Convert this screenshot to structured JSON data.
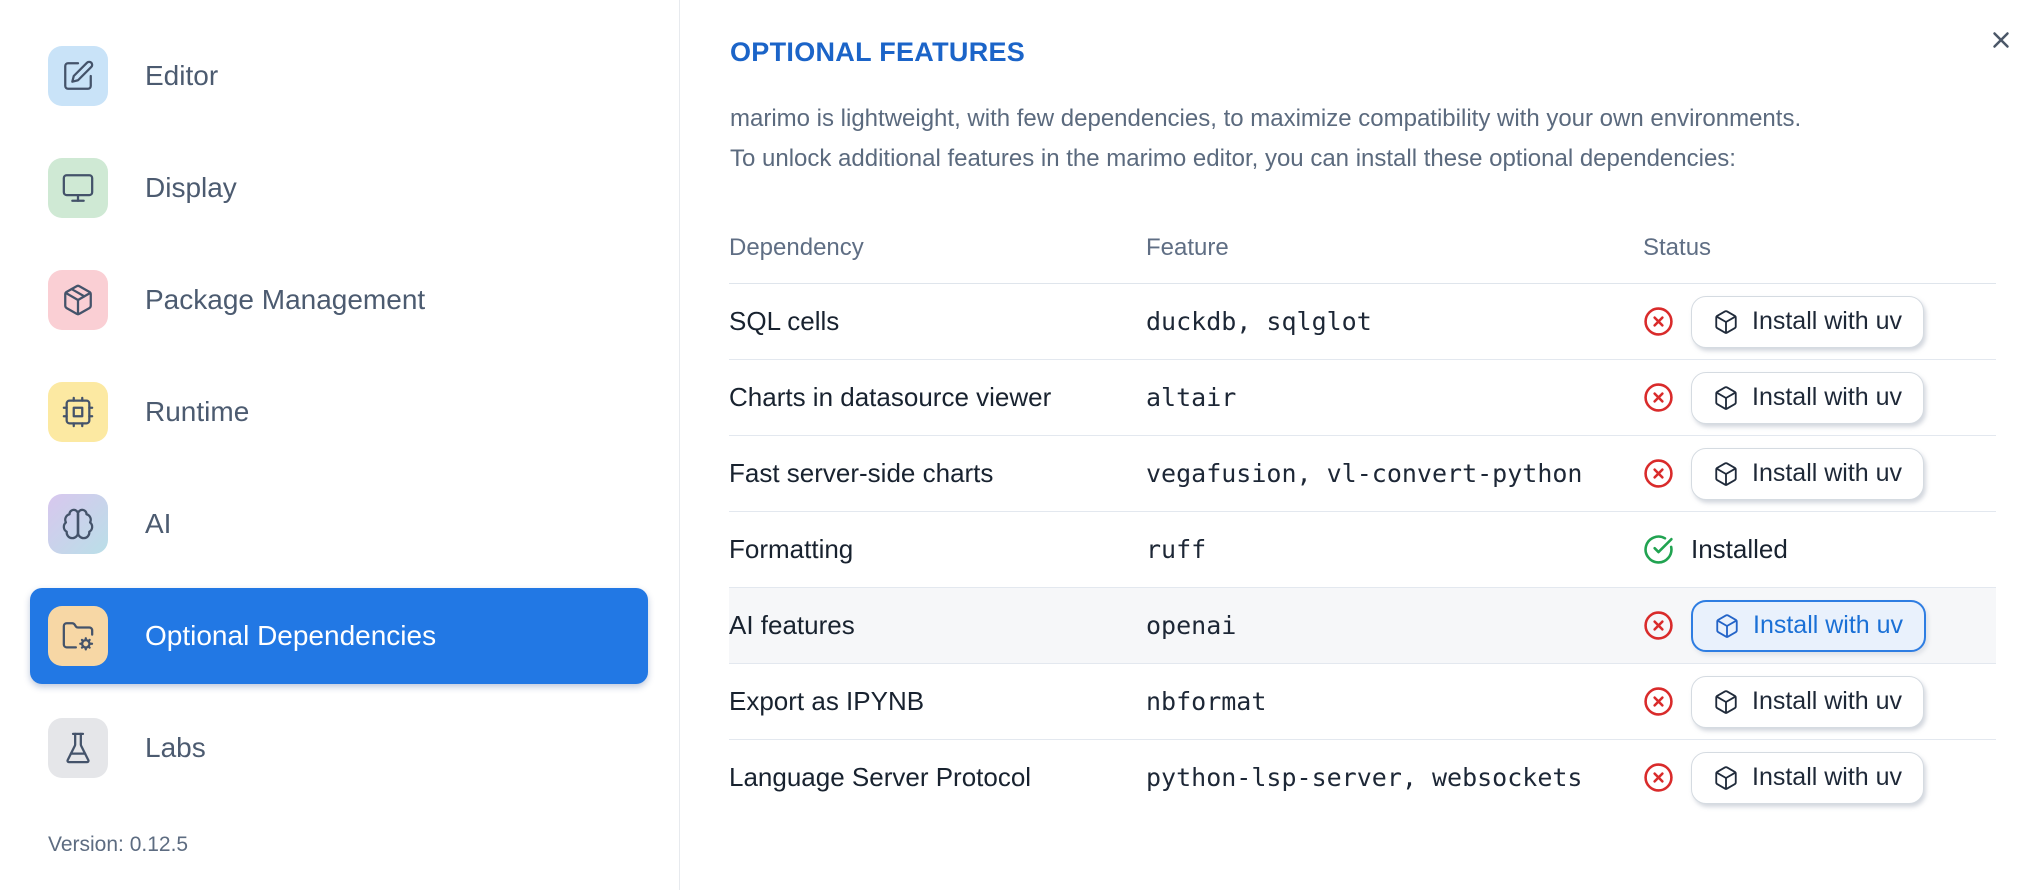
{
  "sidebar": {
    "items": [
      {
        "name": "editor",
        "label": "Editor",
        "icon": "square-pen-icon",
        "tile_bg": "#c9e3f8",
        "selected": false
      },
      {
        "name": "display",
        "label": "Display",
        "icon": "monitor-icon",
        "tile_bg": "#cfe9d4",
        "selected": false
      },
      {
        "name": "package-management",
        "label": "Package Management",
        "icon": "package-icon",
        "tile_bg": "#facfd4",
        "selected": false
      },
      {
        "name": "runtime",
        "label": "Runtime",
        "icon": "cpu-icon",
        "tile_bg": "#fce9a2",
        "selected": false
      },
      {
        "name": "ai",
        "label": "AI",
        "icon": "brain-icon",
        "tile_bg": "linear-gradient(135deg,#d8c7ee,#badfe8)",
        "selected": false
      },
      {
        "name": "optional-dependencies",
        "label": "Optional Dependencies",
        "icon": "folder-cog-icon",
        "tile_bg": "#f7d7a5",
        "selected": true
      },
      {
        "name": "labs",
        "label": "Labs",
        "icon": "flask-icon",
        "tile_bg": "#e5e6e9",
        "selected": false
      }
    ],
    "selected_bg": "#2278e4",
    "version_label": "Version: 0.12.5"
  },
  "dialog": {
    "title": "OPTIONAL FEATURES",
    "description_line1": "marimo is lightweight, with few dependencies, to maximize compatibility with your own environments.",
    "description_line2": "To unlock additional features in the marimo editor, you can install these optional dependencies:",
    "close_icon": "x-icon"
  },
  "table": {
    "columns": [
      "Dependency",
      "Feature",
      "Status"
    ],
    "rows": [
      {
        "dependency": "SQL cells",
        "feature": "duckdb, sqlglot",
        "status": "not-installed",
        "action_label": "Install with uv",
        "highlighted": false
      },
      {
        "dependency": "Charts in datasource viewer",
        "feature": "altair",
        "status": "not-installed",
        "action_label": "Install with uv",
        "highlighted": false
      },
      {
        "dependency": "Fast server-side charts",
        "feature": "vegafusion, vl-convert-python",
        "status": "not-installed",
        "action_label": "Install with uv",
        "highlighted": false
      },
      {
        "dependency": "Formatting",
        "feature": "ruff",
        "status": "installed",
        "status_label": "Installed",
        "highlighted": false
      },
      {
        "dependency": "AI features",
        "feature": "openai",
        "status": "not-installed",
        "action_label": "Install with uv",
        "highlighted": true
      },
      {
        "dependency": "Export as IPYNB",
        "feature": "nbformat",
        "status": "not-installed",
        "action_label": "Install with uv",
        "highlighted": false
      },
      {
        "dependency": "Language Server Protocol",
        "feature": "python-lsp-server, websockets",
        "status": "not-installed",
        "action_label": "Install with uv",
        "highlighted": false
      }
    ]
  },
  "colors": {
    "accent_title_blue": "#1b64c8",
    "selected_nav_blue": "#2278e4",
    "status_red": "#d92b2b",
    "status_green": "#21a351",
    "row_highlight": "#f6f7f9",
    "table_border": "#e3e8ef"
  }
}
